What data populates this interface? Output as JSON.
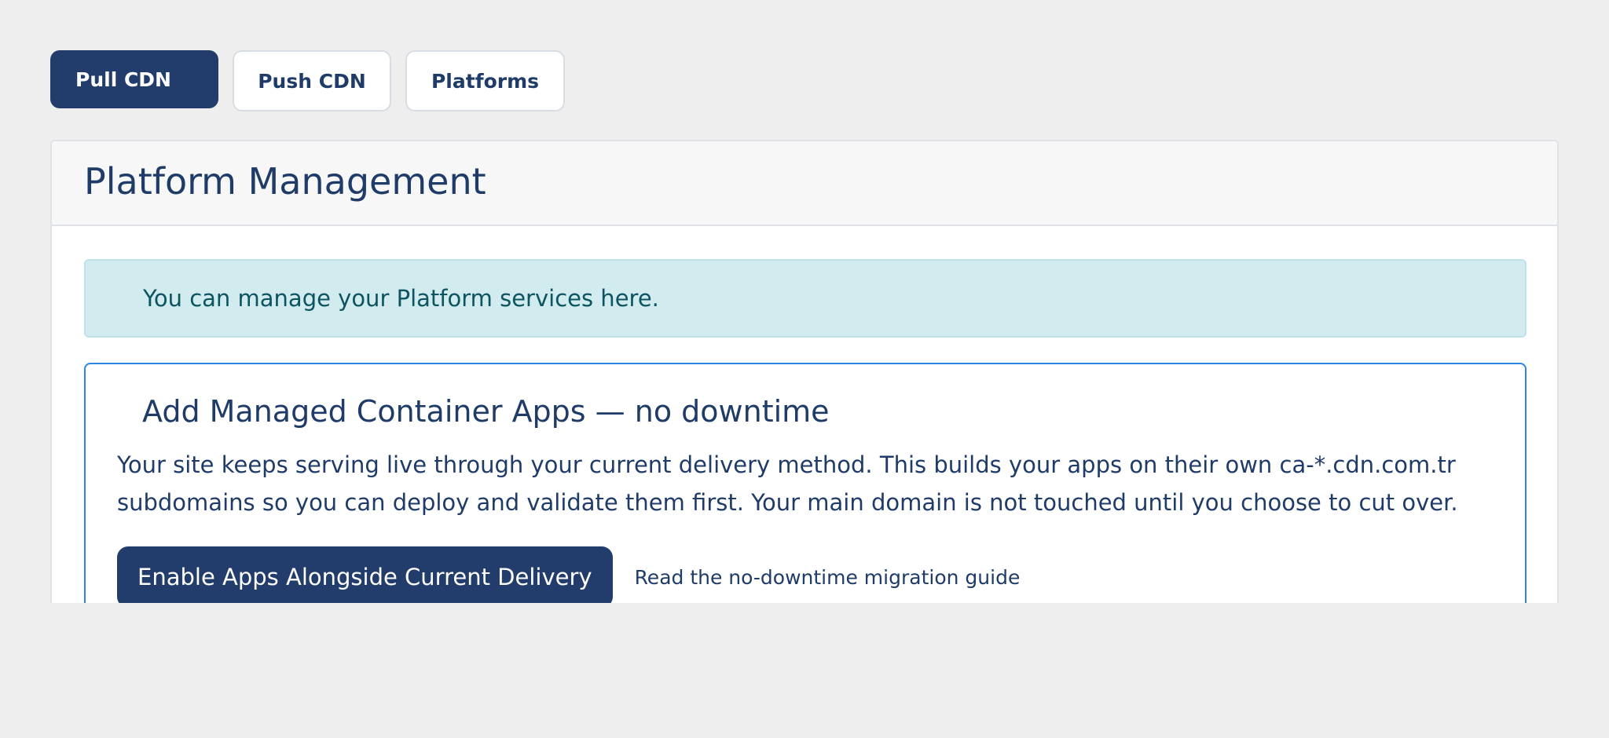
{
  "tabs": [
    {
      "label": "Pull CDN",
      "active": true
    },
    {
      "label": "Push CDN",
      "active": false
    },
    {
      "label": "Platforms",
      "active": false
    }
  ],
  "card": {
    "title": "Platform Management",
    "info_alert": "You can manage your Platform services here."
  },
  "promo": {
    "title": "Add Managed Container Apps — no downtime",
    "description": "Your site keeps serving live through your current delivery method. This builds your apps on their own ca-*.cdn.com.tr subdomains so you can deploy and validate them first. Your main domain is not touched until you choose to cut over.",
    "primary_button": "Enable Apps Alongside Current Delivery",
    "guide_link": "Read the no-downtime migration guide"
  },
  "colors": {
    "page_bg": "#eeeeee",
    "brand_navy": "#223d6c",
    "info_bg": "#d1ebef",
    "info_text": "#0c5460",
    "promo_border": "#2e86de"
  }
}
